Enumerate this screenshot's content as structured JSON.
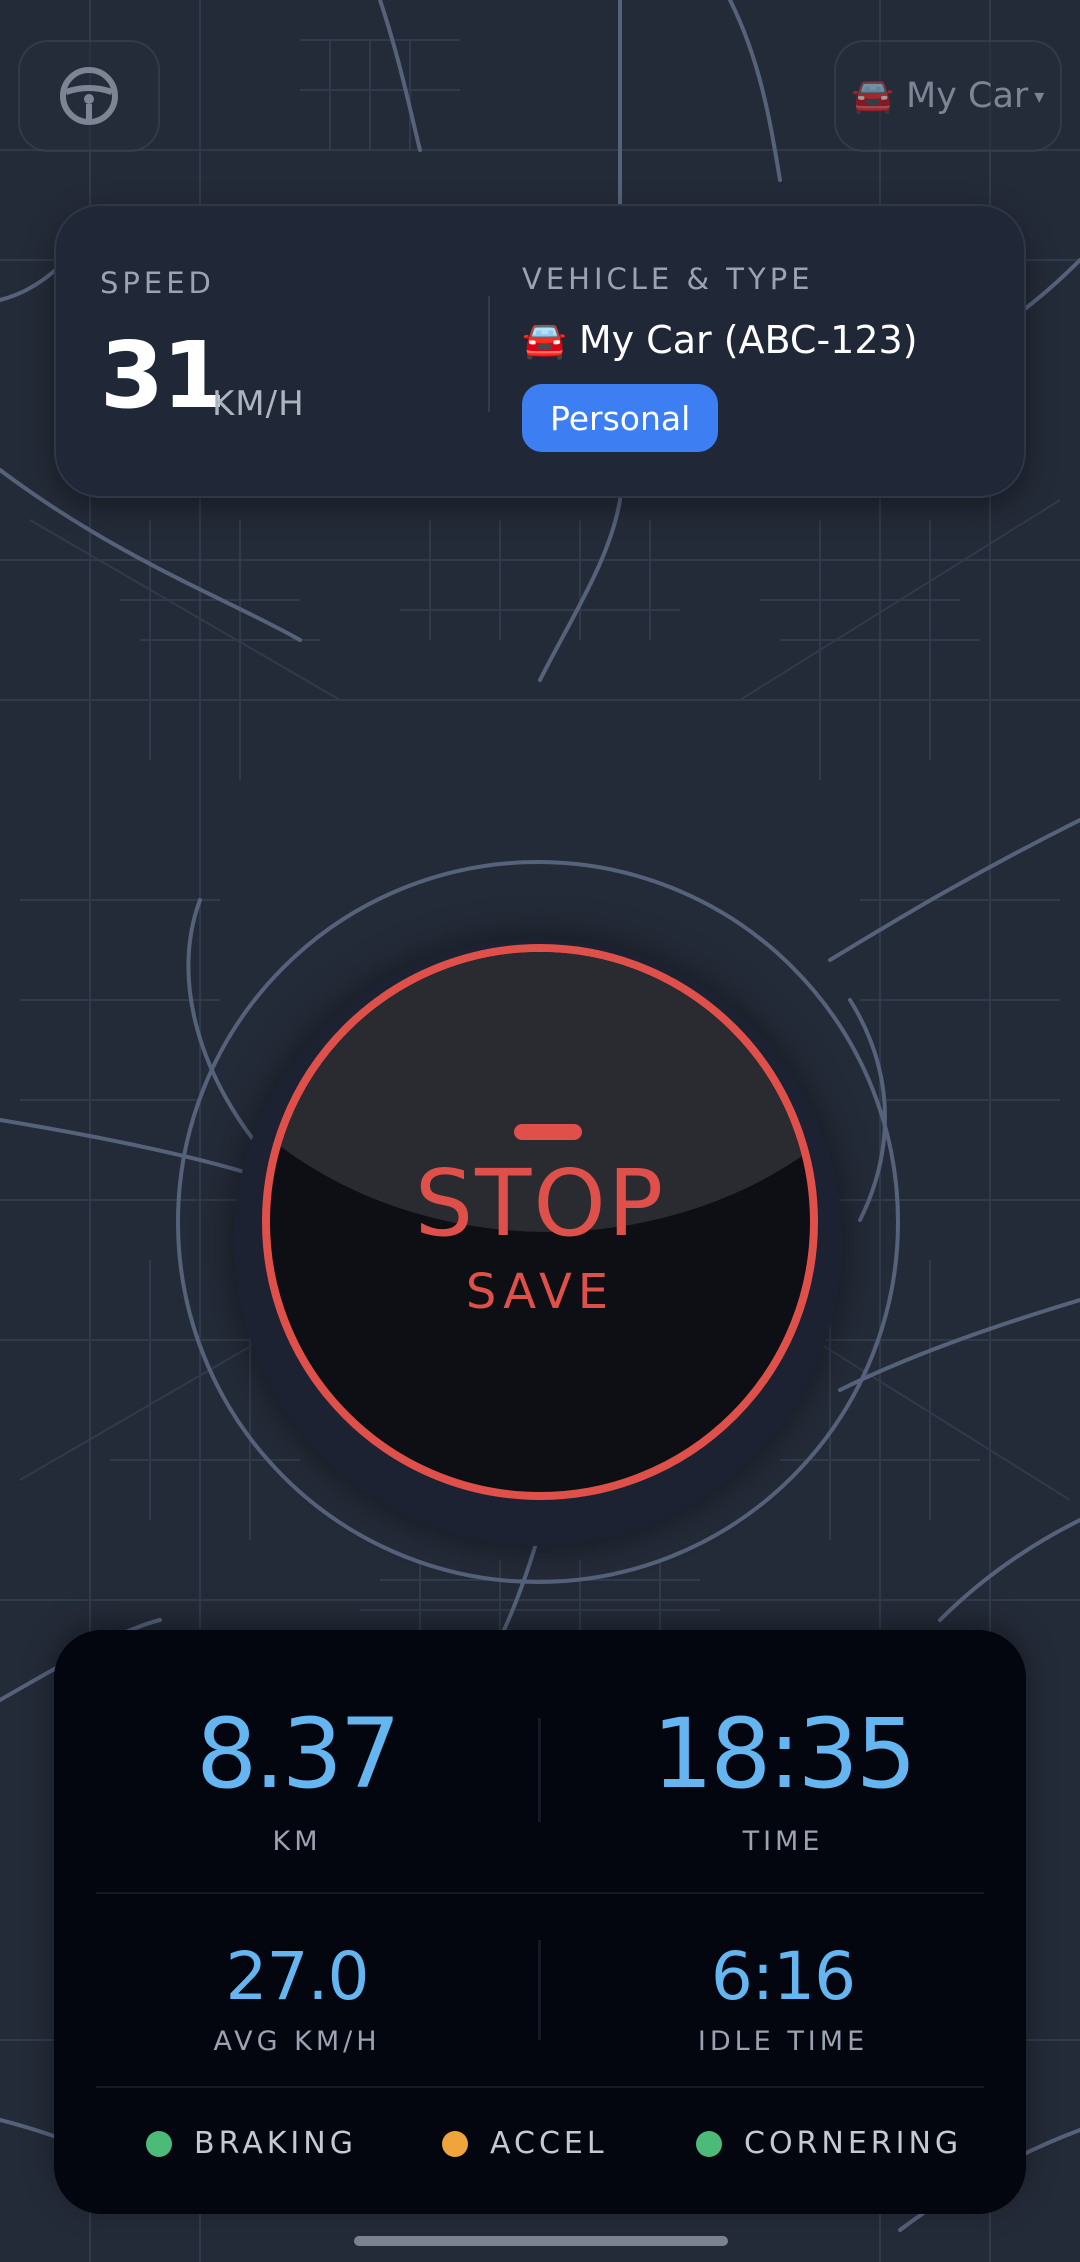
{
  "header": {
    "vehicle_selector": {
      "icon": "car-icon",
      "label": "My Car"
    }
  },
  "speed_card": {
    "speed_caption": "SPEED",
    "speed_value": "31",
    "speed_unit": "KM/H",
    "vehicle_caption": "VEHICLE & TYPE",
    "vehicle_emoji": "🚘",
    "vehicle_name": "My Car (ABC-123)",
    "trip_type": "Personal"
  },
  "stop_button": {
    "primary_label": "STOP",
    "secondary_label": "SAVE"
  },
  "stats": {
    "distance_value": "8.37",
    "distance_label": "KM",
    "time_value": "18:35",
    "time_label": "TIME",
    "avg_speed_value": "27.0",
    "avg_speed_label": "AVG KM/H",
    "idle_time_value": "6:16",
    "idle_time_label": "IDLE TIME"
  },
  "indicators": [
    {
      "label": "BRAKING",
      "status_color": "#4cba78"
    },
    {
      "label": "ACCEL",
      "status_color": "#f0a43c"
    },
    {
      "label": "CORNERING",
      "status_color": "#4cba78"
    }
  ],
  "colors": {
    "accent_red": "#e0504b",
    "accent_blue": "#64b5f0",
    "badge_blue": "#3d7ff2",
    "map_background": "#242b38"
  }
}
